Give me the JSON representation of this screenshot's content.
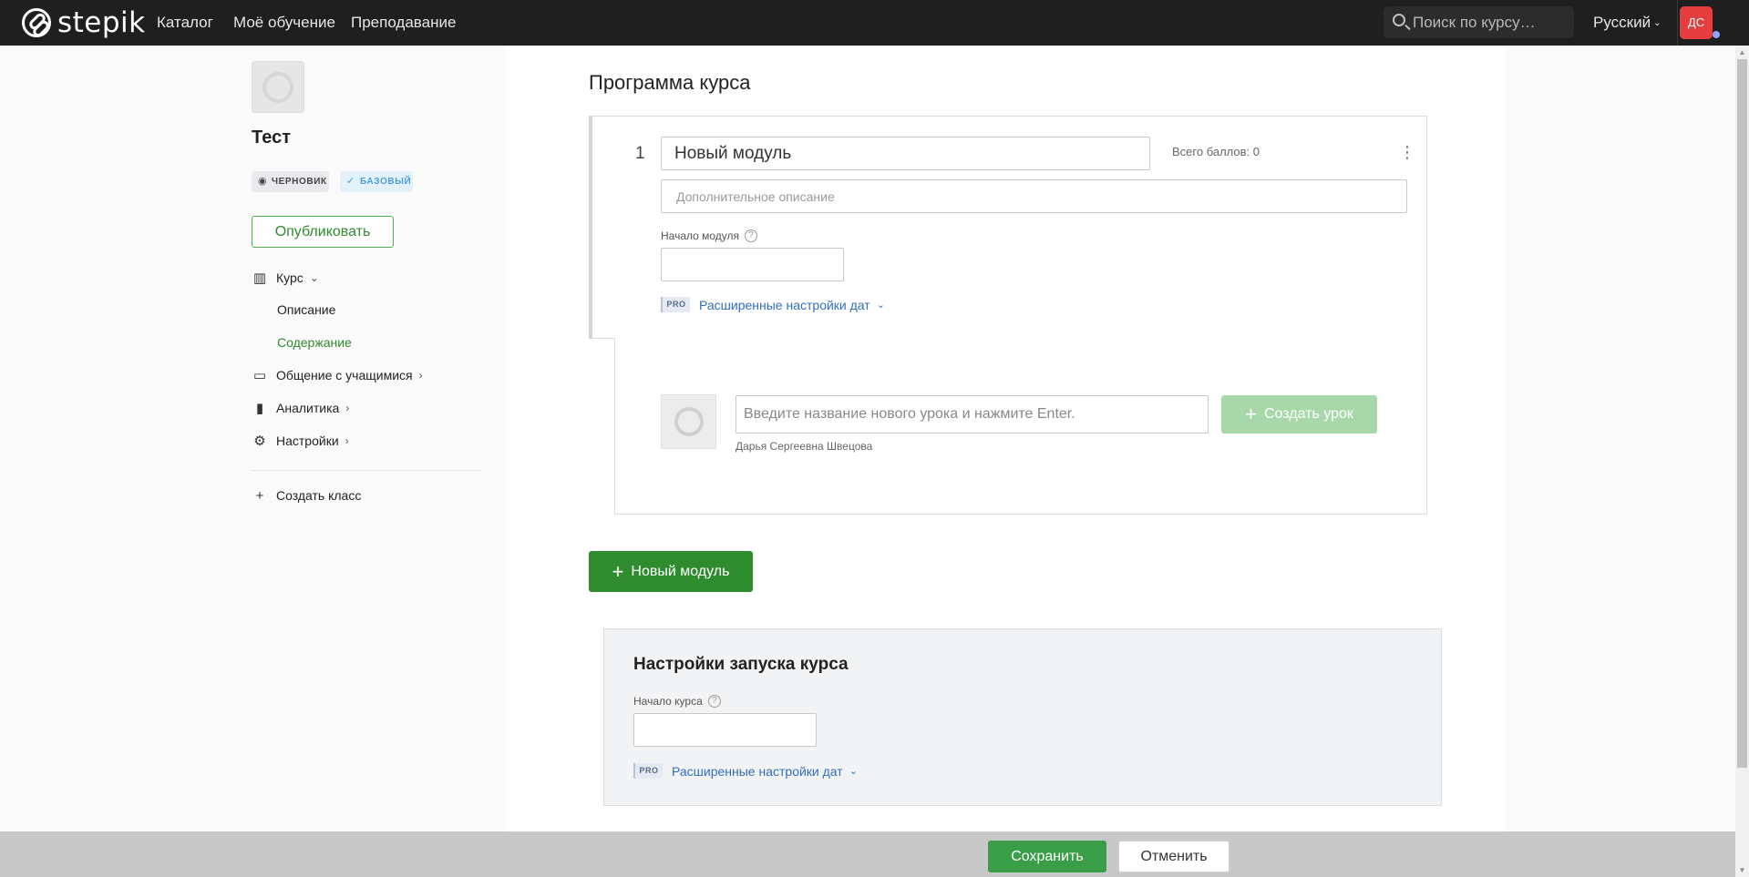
{
  "header": {
    "logo_text": "stepik",
    "nav": [
      "Каталог",
      "Моё обучение",
      "Преподавание"
    ],
    "search_placeholder": "Поиск по курсу…",
    "language": "Русский",
    "avatar_initials": "ДС"
  },
  "sidebar": {
    "course_title": "Тест",
    "badges": {
      "draft": "ЧЕРНОВИК",
      "base": "БАЗОВЫЙ"
    },
    "publish_label": "Опубликовать",
    "menu": {
      "course": "Курс",
      "description": "Описание",
      "content": "Содержание",
      "communication": "Общение с учащимися",
      "analytics": "Аналитика",
      "settings": "Настройки",
      "create_class": "Создать класс"
    }
  },
  "main": {
    "page_title": "Программа курса",
    "module": {
      "number": "1",
      "title_value": "Новый модуль",
      "total_score": "Всего баллов: 0",
      "description_placeholder": "Дополнительное описание",
      "start_label": "Начало модуля",
      "pro_tag": "PRO",
      "advanced_dates": "Расширенные настройки дат"
    },
    "lesson": {
      "input_placeholder": "Введите название нового урока и нажмите Enter.",
      "author": "Дарья Сергеевна Швецова",
      "create_label": "Создать урок"
    },
    "new_module_label": "Новый модуль",
    "launch": {
      "title": "Настройки запуска курса",
      "start_label": "Начало курса",
      "pro_tag": "PRO",
      "advanced_dates": "Расширенные настройки дат"
    }
  },
  "footer": {
    "save_label": "Сохранить",
    "cancel_label": "Отменить"
  },
  "colors": {
    "header_bg": "#1f1f1f",
    "primary_green": "#2e8b2e",
    "disabled_green": "#a8d8a9",
    "link_blue": "#2f6fbd",
    "avatar_red": "#e53e3e"
  }
}
